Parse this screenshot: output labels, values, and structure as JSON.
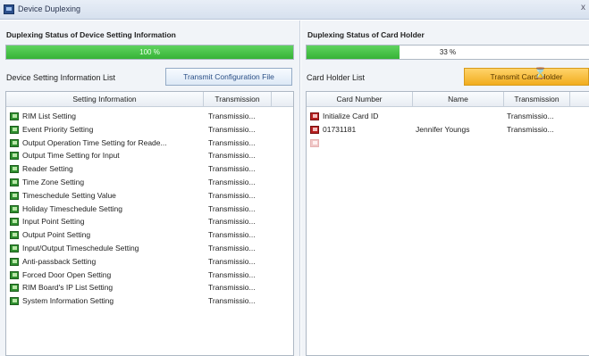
{
  "window": {
    "title": "Device Duplexing",
    "close_label": "x"
  },
  "device_section": {
    "heading": "Duplexing Status of Device Setting Information",
    "progress_text": "100 %",
    "progress_fraction": 1.0,
    "list_label": "Device Setting Information List",
    "transmit_button": "Transmit Configuration File",
    "columns": [
      "Setting Information",
      "Transmission"
    ],
    "rows": [
      {
        "setting": "RIM List Setting",
        "transmission": "Transmissio..."
      },
      {
        "setting": "Event Priority Setting",
        "transmission": "Transmissio..."
      },
      {
        "setting": "Output Operation Time Setting for Reade...",
        "transmission": "Transmissio..."
      },
      {
        "setting": "Output Time Setting for Input",
        "transmission": "Transmissio..."
      },
      {
        "setting": "Reader Setting",
        "transmission": "Transmissio..."
      },
      {
        "setting": "Time Zone Setting",
        "transmission": "Transmissio..."
      },
      {
        "setting": "Timeschedule Setting Value",
        "transmission": "Transmissio..."
      },
      {
        "setting": "Holiday Timeschedule Setting",
        "transmission": "Transmissio..."
      },
      {
        "setting": "Input Point Setting",
        "transmission": "Transmissio..."
      },
      {
        "setting": "Output Point Setting",
        "transmission": "Transmissio..."
      },
      {
        "setting": "Input/Output Timeschedule Setting",
        "transmission": "Transmissio..."
      },
      {
        "setting": "Anti-passback Setting",
        "transmission": "Transmissio..."
      },
      {
        "setting": "Forced Door Open Setting",
        "transmission": "Transmissio..."
      },
      {
        "setting": "RIM Board's IP List Setting",
        "transmission": "Transmissio..."
      },
      {
        "setting": "System Information Setting",
        "transmission": "Transmissio..."
      }
    ]
  },
  "card_section": {
    "heading": "Duplexing Status of Card Holder",
    "progress_text": "33 %",
    "progress_fraction": 0.33,
    "list_label": "Card Holder List",
    "transmit_button": "Transmit Card Holder",
    "columns": [
      "Card Number",
      "Name",
      "Transmission"
    ],
    "rows": [
      {
        "card": "Initialize Card ID",
        "name": "",
        "transmission": "Transmissio..."
      },
      {
        "card": "01731181",
        "name": "Jennifer Youngs",
        "transmission": "Transmissio..."
      },
      {
        "card": "",
        "name": "",
        "transmission": ""
      }
    ]
  },
  "colors": {
    "progress_green": "#36b336",
    "button_orange": "#f1ad1e",
    "row_icon_green": "#2f8f2f",
    "card_icon_red": "#b81f1f"
  },
  "icons": {
    "window": "app-icon",
    "setting_row": "setting-item-icon",
    "card_row": "card-holder-icon",
    "cursor": "hourglass-icon"
  }
}
